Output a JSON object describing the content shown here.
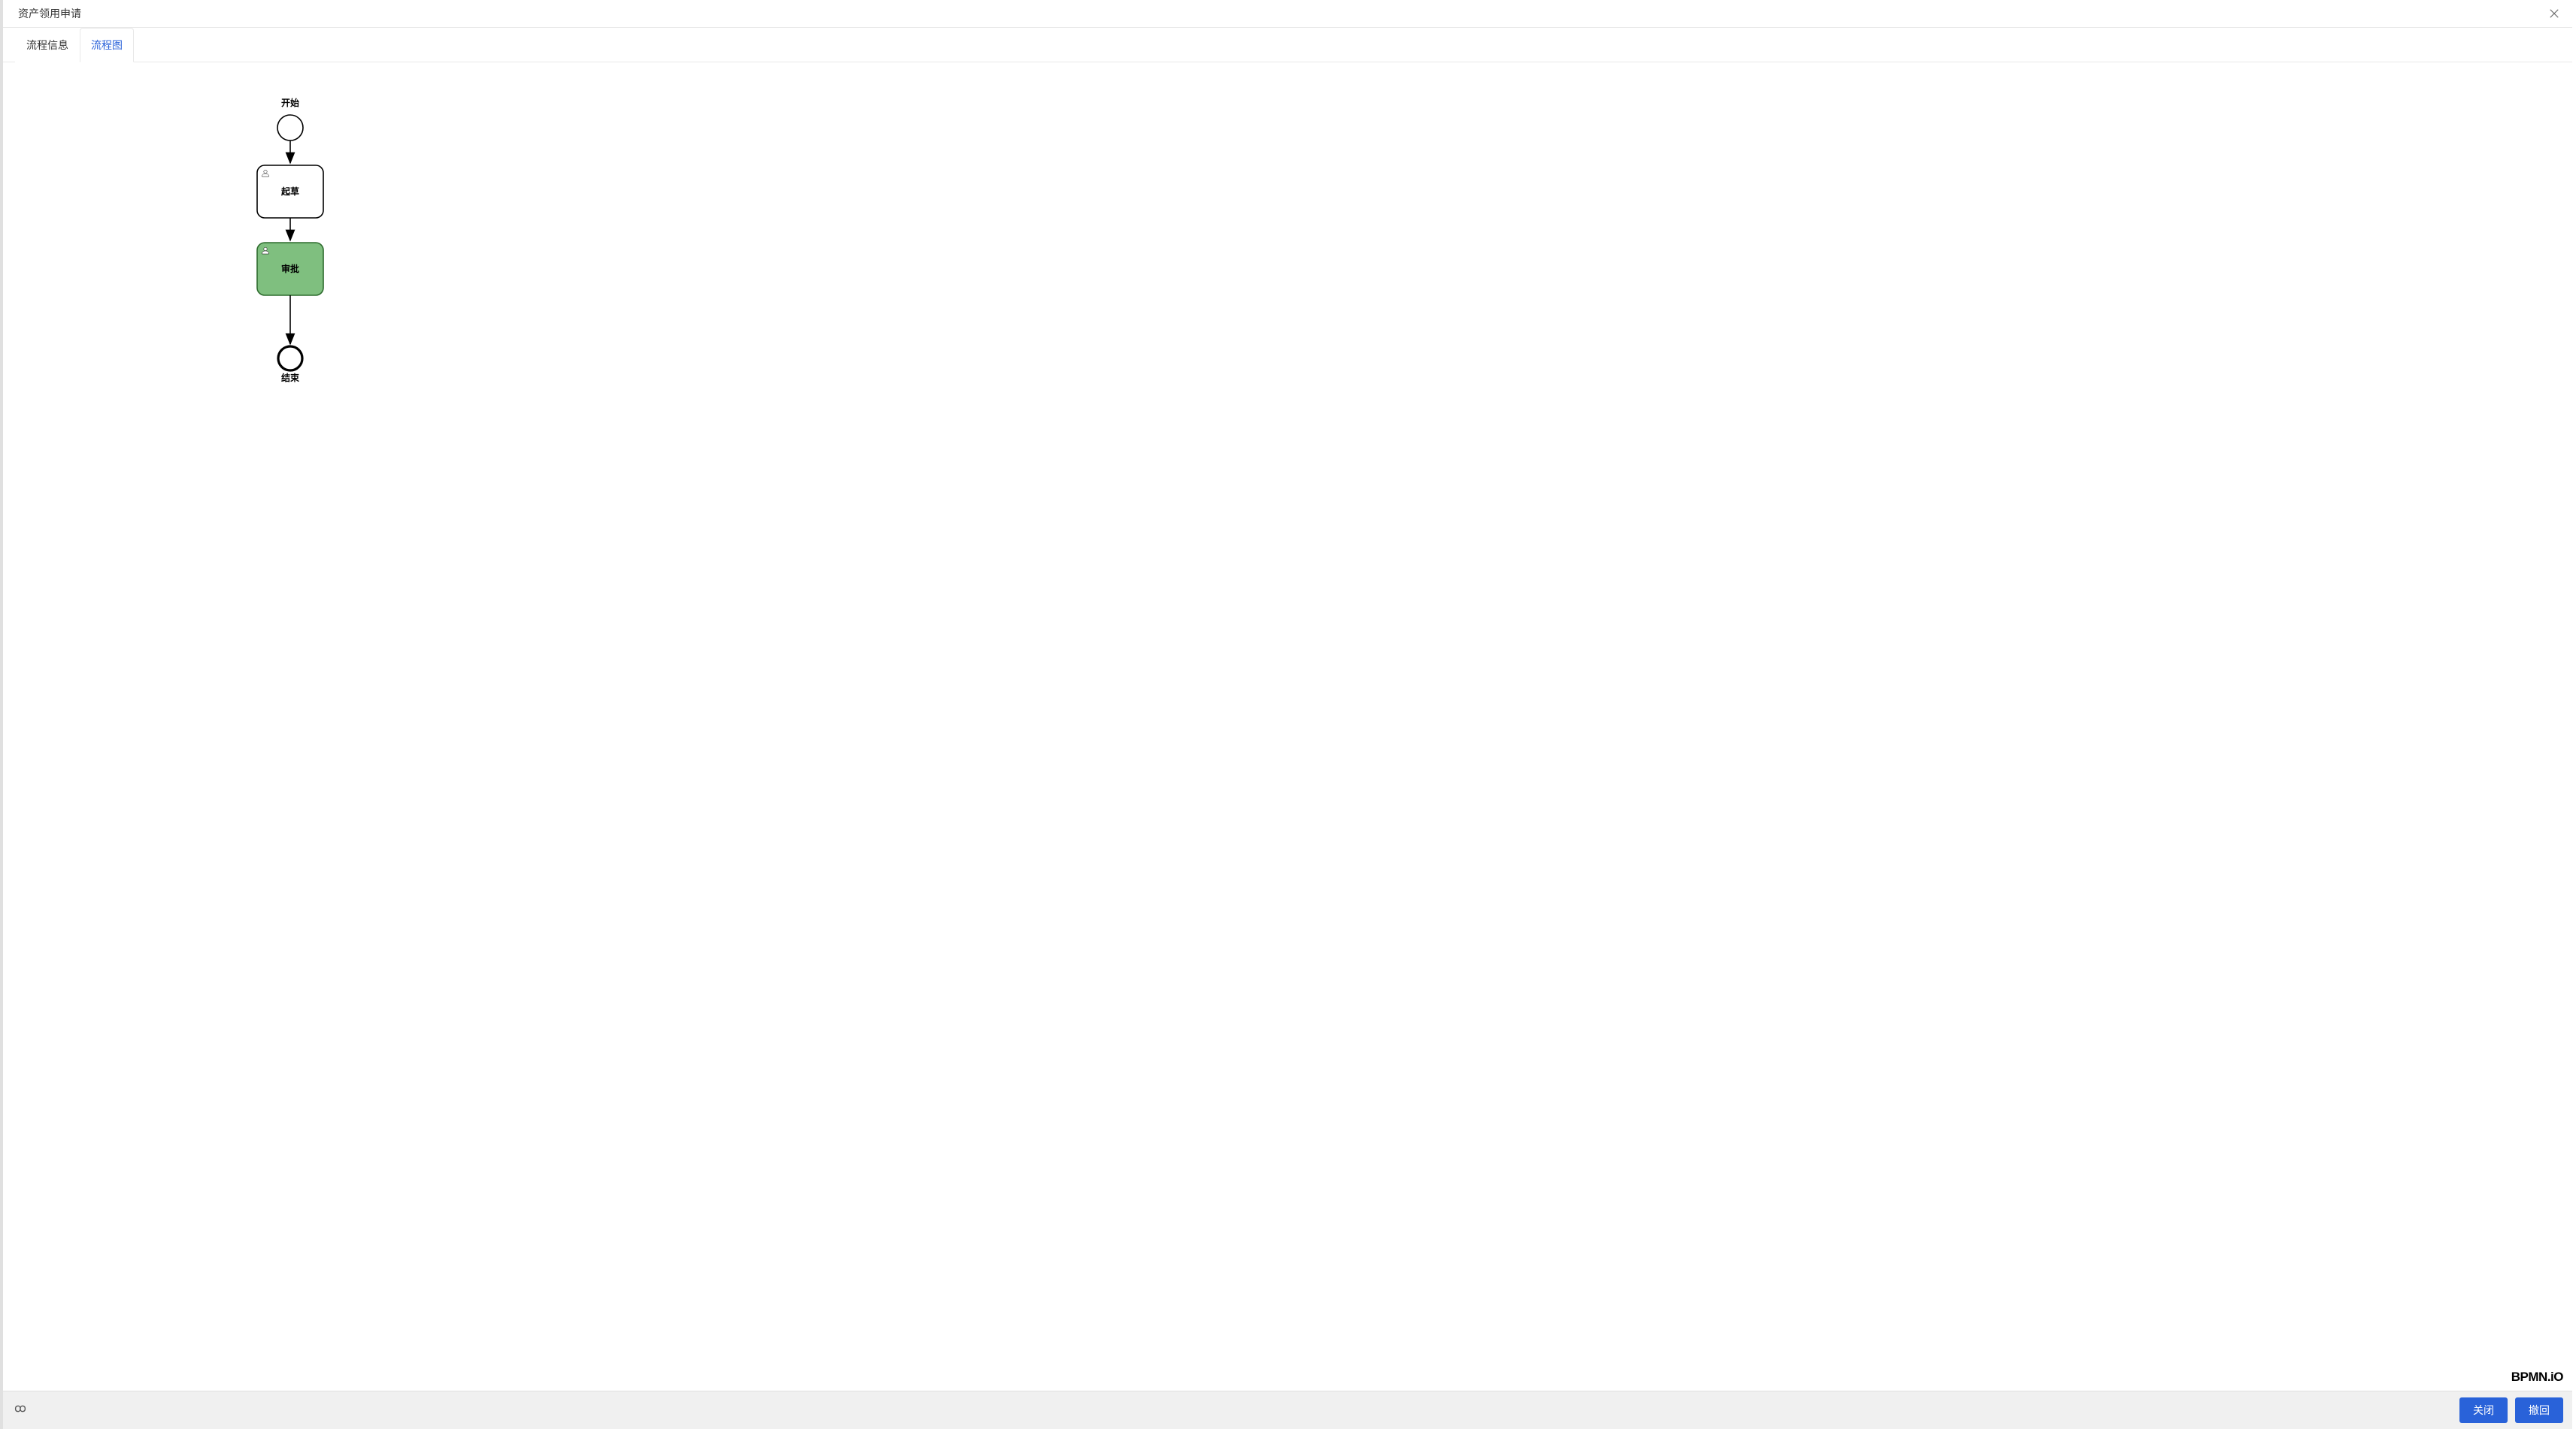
{
  "modal": {
    "title": "资产领用申请"
  },
  "tabs": [
    {
      "label": "流程信息",
      "active": false
    },
    {
      "label": "流程图",
      "active": true
    }
  ],
  "diagram": {
    "logo_text": "BPMN.iO",
    "nodes": {
      "start": {
        "label": "开始",
        "type": "start-event"
      },
      "draft": {
        "label": "起草",
        "type": "user-task",
        "highlighted": false
      },
      "approve": {
        "label": "审批",
        "type": "user-task",
        "highlighted": true
      },
      "end": {
        "label": "结束",
        "type": "end-event"
      }
    },
    "colors": {
      "highlight_fill": "#7fbf7f",
      "highlight_stroke": "#2d6b2d",
      "default_stroke": "#000000",
      "default_fill": "#ffffff"
    }
  },
  "footer": {
    "close_label": "关闭",
    "withdraw_label": "撤回"
  }
}
